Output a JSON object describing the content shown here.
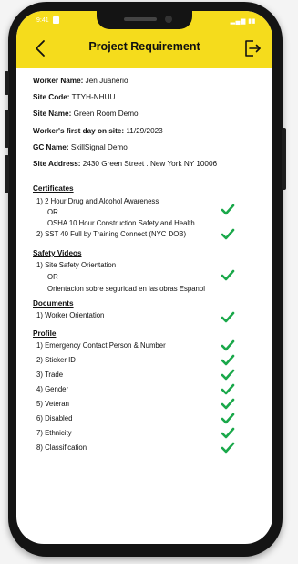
{
  "status_bar": {
    "time": "9:41",
    "indicators": "▂▄▆ ▮▮"
  },
  "header": {
    "title": "Project Requirement",
    "back_icon": "chevron-left-icon",
    "exit_icon": "exit-icon",
    "background_color": "#f5dc1c"
  },
  "worker_info": [
    {
      "label": "Worker Name:",
      "value": "Jen Juanerio"
    },
    {
      "label": "Site Code:",
      "value": "TTYH-NHUU"
    },
    {
      "label": "Site Name:",
      "value": "Green Room Demo"
    },
    {
      "label": "Worker's first day on site:",
      "value": "11/29/2023"
    },
    {
      "label": "GC Name:",
      "value": "SkillSignal Demo"
    },
    {
      "label": "Site Address:",
      "value": "2430 Green Street . New York NY 10006"
    }
  ],
  "certificates": {
    "title": "Certificates",
    "lines": [
      "1) 2 Hour Drug and Alcohol Awareness",
      "OR",
      "OSHA 10 Hour Construction Safety and Health",
      "2) SST 40 Full by Training Connect (NYC DOB)"
    ]
  },
  "safety_videos": {
    "title": "Safety Videos",
    "lines": [
      "1) Site Safety Orientation",
      "OR",
      "Orientacion sobre seguridad en las obras Espanol"
    ]
  },
  "documents": {
    "title": "Documents",
    "lines": [
      "1) Worker Orientation"
    ]
  },
  "profile": {
    "title": "Profile",
    "items": [
      "1) Emergency Contact Person & Number",
      "2) Sticker ID",
      "3) Trade",
      "4) Gender",
      "5) Veteran",
      "6) Disabled",
      "7) Ethnicity",
      "8) Classification"
    ]
  },
  "colors": {
    "check": "#1aa84a",
    "accent": "#f5dc1c"
  },
  "check_icon": "checkmark-icon"
}
